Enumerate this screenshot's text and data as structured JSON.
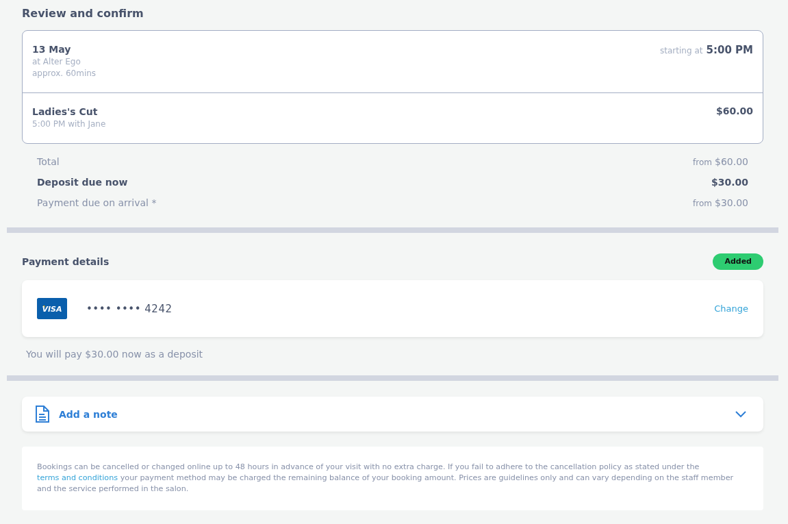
{
  "title": "Review and confirm",
  "appointment": {
    "date": "13 May",
    "location": "at Alter Ego",
    "duration": "approx. 60mins",
    "start_prefix": "starting at",
    "start_time": "5:00 PM"
  },
  "services": [
    {
      "name": "Ladies's Cut",
      "detail": "5:00 PM with Jane",
      "price": "$60.00"
    }
  ],
  "totals": [
    {
      "label": "Total",
      "prefix": "from",
      "amount": "$60.00",
      "emphasis": false
    },
    {
      "label": "Deposit due now",
      "amount": "$30.00",
      "emphasis": true
    },
    {
      "label": "Payment due on arrival *",
      "prefix": "from",
      "amount": "$30.00",
      "emphasis": false
    }
  ],
  "payment": {
    "heading": "Payment details",
    "badge": "Added",
    "card_brand": "VISA",
    "card_number": "•••• •••• 4242",
    "change_link": "Change",
    "deposit_note": "You will pay $30.00 now as a deposit"
  },
  "note": {
    "label": "Add a note",
    "expanded": false
  },
  "policy": {
    "before": "Bookings can be cancelled or changed online up to 48 hours in advance of your visit with no extra charge. If you fail to adhere to the cancellation policy as stated under the",
    "link": "terms and conditions",
    "after": "your payment method may be charged the remaining balance of your booking amount. Prices are guidelines only and can vary depending on the staff member and the service performed in the salon."
  }
}
